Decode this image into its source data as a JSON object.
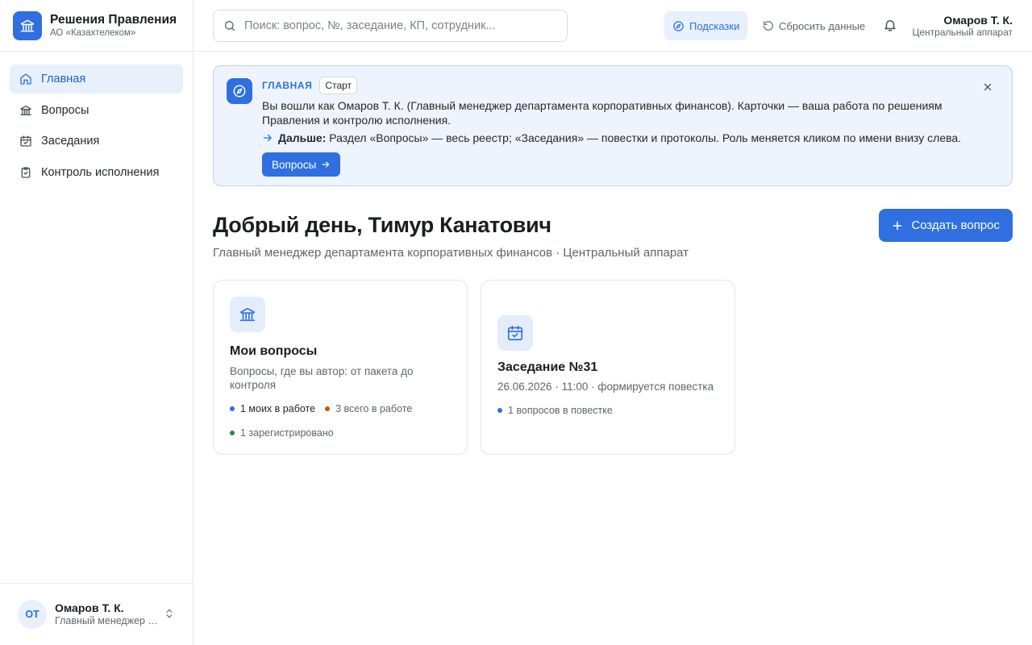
{
  "brand": {
    "title": "Решения Правления",
    "subtitle": "АО «Казахтелеком»",
    "logo_icon": "bank-icon"
  },
  "sidebar": {
    "items": [
      {
        "label": "Главная",
        "icon": "home-icon",
        "active": true
      },
      {
        "label": "Вопросы",
        "icon": "bank-icon",
        "active": false
      },
      {
        "label": "Заседания",
        "icon": "calendar-check-icon",
        "active": false
      },
      {
        "label": "Контроль исполнения",
        "icon": "clipboard-check-icon",
        "active": false
      }
    ],
    "user": {
      "initials": "ОТ",
      "name": "Омаров Т. К.",
      "role": "Главный менеджер департамента корпоративных финансов"
    }
  },
  "topbar": {
    "search_placeholder": "Поиск: вопрос, №, заседание, КП, сотрудник...",
    "hints_label": "Подсказки",
    "reset_label": "Сбросить данные",
    "user_name": "Омаров Т. К.",
    "user_unit": "Центральный аппарат"
  },
  "banner": {
    "tag": "ГЛАВНАЯ",
    "chip": "Старт",
    "text": "Вы вошли как Омаров Т. К. (Главный менеджер департамента корпоративных финансов). Карточки — ваша работа по решениям Правления и контролю исполнения.",
    "next_label": "Дальше:",
    "next_text": "Раздел «Вопросы» — весь реестр; «Заседания» — повестки и протоколы. Роль меняется кликом по имени внизу слева.",
    "cta": "Вопросы"
  },
  "greeting": {
    "title": "Добрый день, Тимур Канатович",
    "subtitle": "Главный менеджер департамента корпоративных финансов · Центральный аппарат",
    "create_label": "Создать вопрос"
  },
  "cards": [
    {
      "title": "Мои вопросы",
      "desc": "Вопросы, где вы автор: от пакета до контроля",
      "stats": [
        {
          "text": "1 моих в работе",
          "color": "#2f6fe0"
        },
        {
          "text": "3 всего в работе",
          "color": "#c2570c"
        },
        {
          "text": "1 зарегистрировано",
          "color": "#2e8b3c"
        }
      ]
    },
    {
      "title": "Заседание №31",
      "desc": "26.06.2026 · 11:00 · формируется повестка",
      "stats": [
        {
          "text": "1 вопросов в повестке",
          "color": "#2f6fe0"
        }
      ]
    }
  ],
  "colors": {
    "accent": "#2f6fe0",
    "accent_soft": "#e8f0fc",
    "border": "#e6e8eb"
  }
}
